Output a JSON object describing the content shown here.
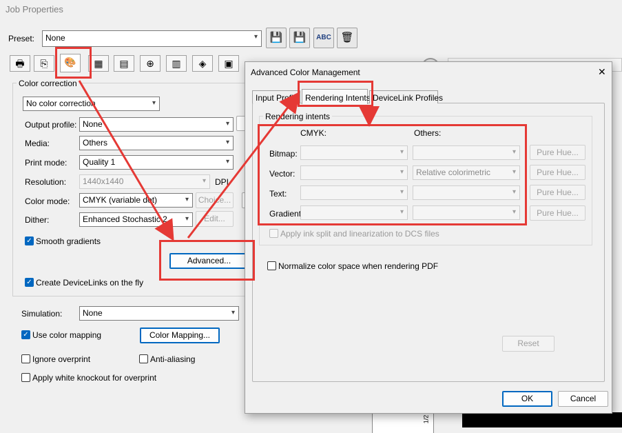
{
  "window_title": "Job Properties",
  "preset": {
    "label": "Preset:",
    "value": "None"
  },
  "color_correction": {
    "group_label": "Color correction",
    "mode": "No color correction",
    "output_profile": {
      "label": "Output profile:",
      "value": "None"
    },
    "media": {
      "label": "Media:",
      "value": "Others"
    },
    "print_mode": {
      "label": "Print mode:",
      "value": "Quality 1"
    },
    "resolution": {
      "label": "Resolution:",
      "value": "1440x1440",
      "unit": "DPI"
    },
    "color_mode": {
      "label": "Color mode:",
      "value": "CMYK (variable dot)",
      "button": "Choice..."
    },
    "dither": {
      "label": "Dither:",
      "value": "Enhanced Stochastic 2",
      "button": "Edit..."
    },
    "smooth_gradients": "Smooth gradients",
    "advanced_button": "Advanced...",
    "create_devicelinks": "Create DeviceLinks on the fly"
  },
  "simulation": {
    "label": "Simulation:",
    "value": "None"
  },
  "use_color_mapping": "Use color mapping",
  "color_mapping_button": "Color Mapping...",
  "ignore_overprint": "Ignore overprint",
  "anti_aliasing": "Anti-aliasing",
  "white_knockout": "Apply white knockout for overprint",
  "ruler_mark": "1/2",
  "dialog": {
    "title": "Advanced Color Management",
    "close": "✕",
    "tabs": [
      "Input Profiles",
      "Rendering Intents",
      "DeviceLink Profiles"
    ],
    "group_label": "Rendering intents",
    "col_cmyk": "CMYK:",
    "col_others": "Others:",
    "rows": [
      {
        "label": "Bitmap:",
        "cmyk": "",
        "others": "",
        "button": "Pure Hue..."
      },
      {
        "label": "Vector:",
        "cmyk": "",
        "others": "Relative colorimetric",
        "button": "Pure Hue..."
      },
      {
        "label": "Text:",
        "cmyk": "",
        "others": "",
        "button": "Pure Hue..."
      },
      {
        "label": "Gradient:",
        "cmyk": "",
        "others": "",
        "button": "Pure Hue..."
      }
    ],
    "apply_ink_split": "Apply ink split and linearization to DCS files",
    "normalize": "Normalize color space when rendering PDF",
    "reset": "Reset",
    "ok": "OK",
    "cancel": "Cancel"
  }
}
